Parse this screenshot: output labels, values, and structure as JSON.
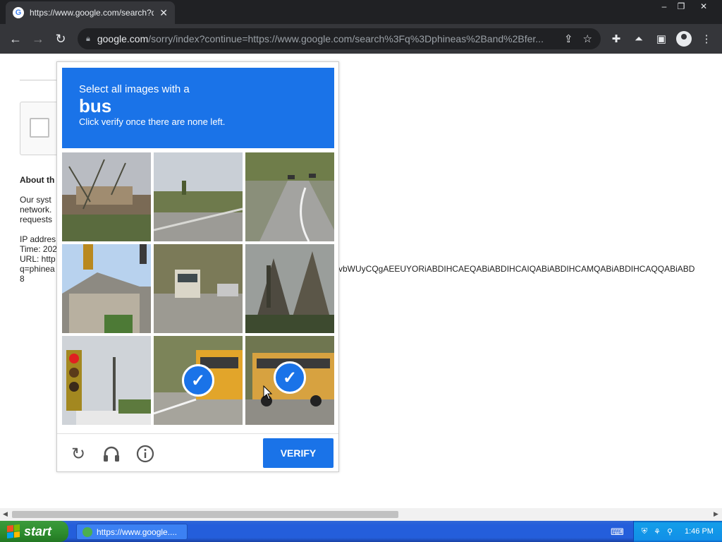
{
  "browser": {
    "tab_title": "https://www.google.com/search?q=",
    "tab_favicon": "G",
    "url_host": "google.com",
    "url_rest": "/sorry/index?continue=https://www.google.com/search%3Fq%3Dphineas%2Band%2Bfer...",
    "window_controls": [
      "–",
      "❐",
      "✕"
    ]
  },
  "page": {
    "about_heading": "About th",
    "lines": [
      "Our syst",
      "network.",
      "requests",
      "IP addres",
      "Time: 202",
      "URL: http",
      "q=phinea",
      "8"
    ],
    "url_tail": "vbWUyCQgAEEUYORiABDIHCAEQABiABDIHCAIQABiABDIHCAMQABiABDIHCAQQABiABD"
  },
  "captcha": {
    "instruction_line1": "Select all images with a",
    "target_word": "bus",
    "instruction_line3": "Click verify once there are none left.",
    "accent_color": "#1a73e8",
    "tiles": [
      {
        "label": "tile-1",
        "selected": false
      },
      {
        "label": "tile-2",
        "selected": false
      },
      {
        "label": "tile-3",
        "selected": false
      },
      {
        "label": "tile-4",
        "selected": false
      },
      {
        "label": "tile-5",
        "selected": false
      },
      {
        "label": "tile-6",
        "selected": false
      },
      {
        "label": "tile-7",
        "selected": false
      },
      {
        "label": "tile-8",
        "selected": true
      },
      {
        "label": "tile-9",
        "selected": true
      }
    ],
    "verify_label": "VERIFY",
    "footer_icons": [
      "reload-icon",
      "headphones-icon",
      "info-icon"
    ]
  },
  "taskbar": {
    "start_label": "start",
    "task_item_label": "https://www.google....",
    "clock": "1:46 PM"
  }
}
